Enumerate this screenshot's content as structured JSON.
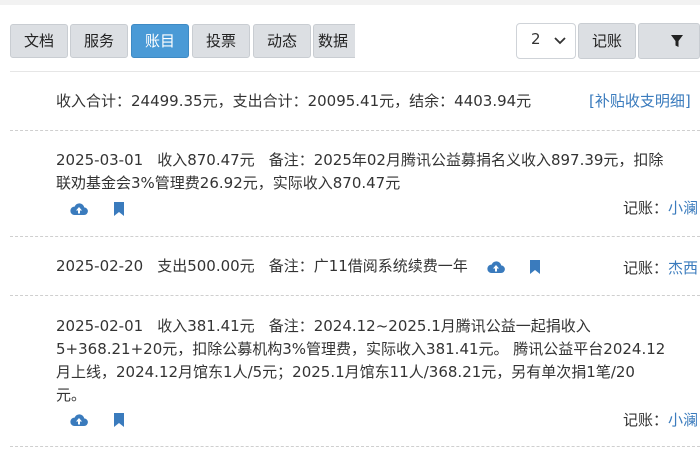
{
  "tabs": [
    {
      "label": "文档",
      "active": false
    },
    {
      "label": "服务",
      "active": false
    },
    {
      "label": "账目",
      "active": true
    },
    {
      "label": "投票",
      "active": false
    },
    {
      "label": "动态",
      "active": false
    },
    {
      "label": "数据",
      "active": false
    }
  ],
  "toolbar": {
    "select_value": "2",
    "record_label": "记账"
  },
  "summary": {
    "text": "收入合计：24499.35元，支出合计：20095.41元，结余：4403.94元",
    "supplement_link": "[补贴收支明细]"
  },
  "entries": [
    {
      "date": "2025-03-01",
      "amount": "收入870.47元",
      "note_line1": "备注：2025年02月腾讯公益募捐名义收入897.39元，扣除",
      "note_line2": "联劝基金会3%管理费26.92元，实际收入870.47元",
      "recorder_label": "记账：",
      "recorder_name": "小澜"
    },
    {
      "date": "2025-02-20",
      "amount": "支出500.00元",
      "note_line1": "备注：广11借阅系统续费一年",
      "recorder_label": "记账：",
      "recorder_name": "杰西"
    },
    {
      "date": "2025-02-01",
      "amount": "收入381.41元",
      "note_line1": "备注：2024.12~2025.1月腾讯公益一起捐收入",
      "note_line2": "5+368.21+20元，扣除公募机构3%管理费，实际收入381.41元。 腾讯公益平台2024.12",
      "note_line3": "月上线，2024.12月馆东1人/5元；2025.1月馆东11人/368.21元，另有单次捐1笔/20",
      "note_line4": "元。",
      "recorder_label": "记账：",
      "recorder_name": "小澜"
    }
  ],
  "colors": {
    "accent": "#4a9ad6",
    "link": "#3a7bbd",
    "icon": "#3a7bbd"
  },
  "icons": [
    "chevron-down-icon",
    "filter-icon",
    "cloud-upload-icon",
    "bookmark-icon"
  ]
}
